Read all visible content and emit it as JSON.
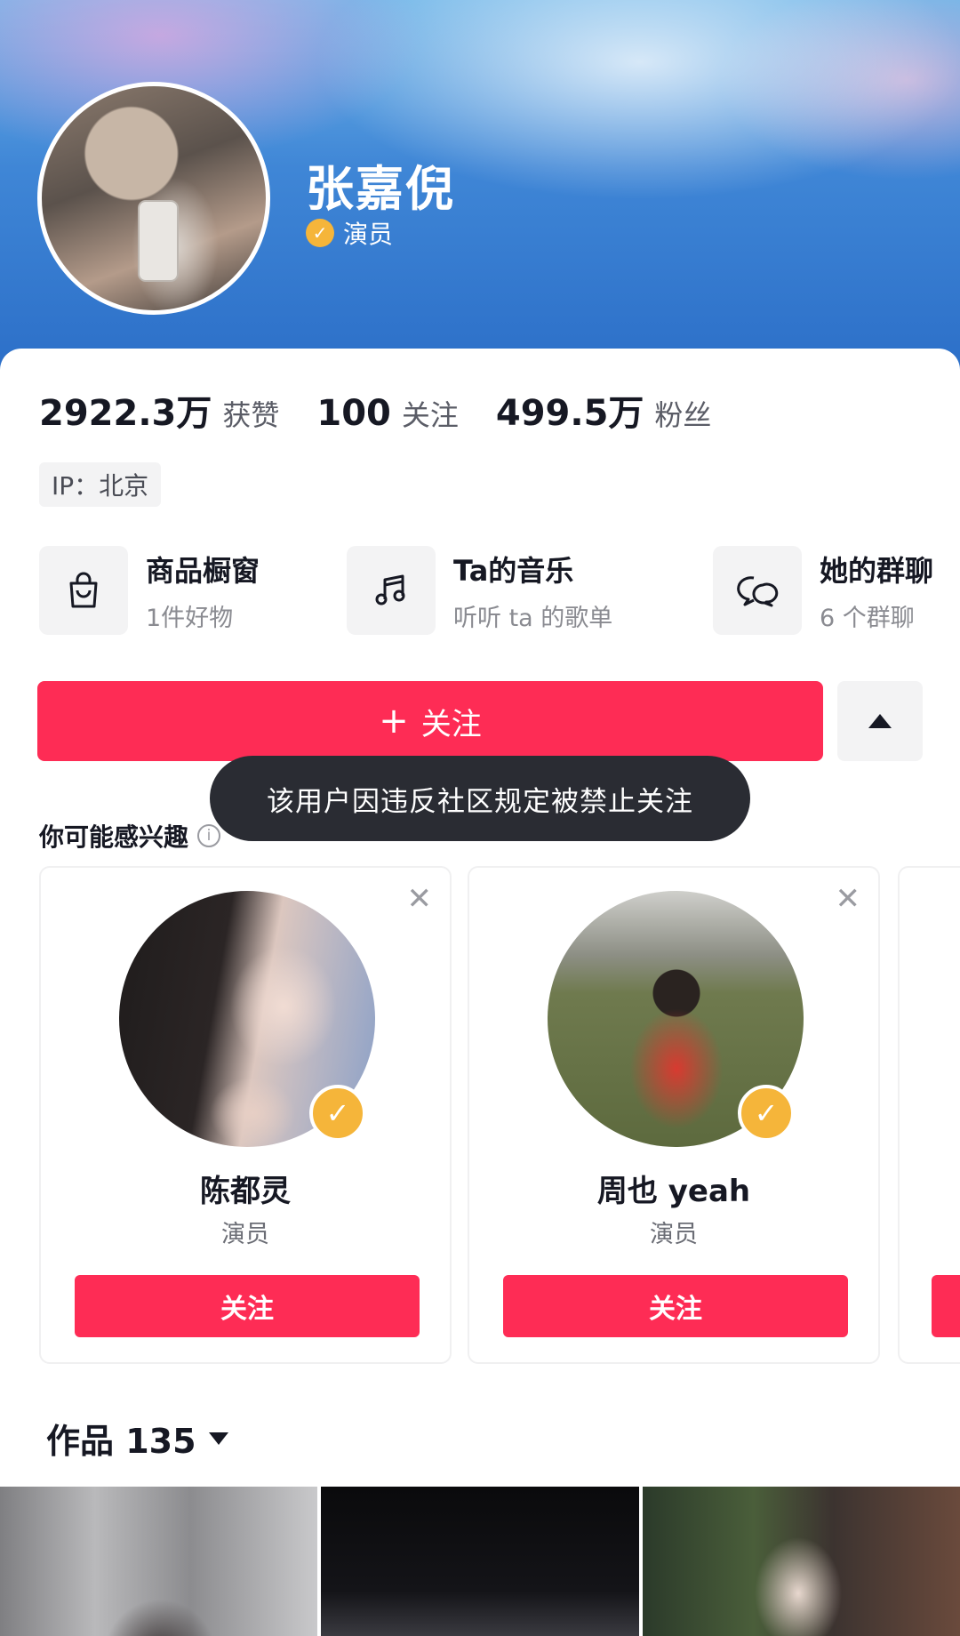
{
  "profile": {
    "name": "张嘉倪",
    "verify_label": "演员",
    "verify_icon": "check-badge-icon"
  },
  "stats": [
    {
      "value": "2922.3万",
      "label": "获赞"
    },
    {
      "value": "100",
      "label": "关注"
    },
    {
      "value": "499.5万",
      "label": "粉丝"
    }
  ],
  "ip": "IP：北京",
  "features": [
    {
      "title": "商品橱窗",
      "subtitle": "1件好物",
      "icon": "shopping-bag-icon"
    },
    {
      "title": "Ta的音乐",
      "subtitle": "听听 ta 的歌单",
      "icon": "music-note-icon"
    },
    {
      "title": "她的群聊",
      "subtitle": "6 个群聊",
      "icon": "chat-bubbles-icon"
    }
  ],
  "follow_button": {
    "icon": "+",
    "label": "关注"
  },
  "toast": "该用户因违反社区规定被禁止关注",
  "suggestions": {
    "title": "你可能感兴趣",
    "cards": [
      {
        "name": "陈都灵",
        "role": "演员",
        "button": "关注"
      },
      {
        "name": "周也 yeah",
        "role": "演员",
        "button": "关注"
      }
    ]
  },
  "works": {
    "label": "作品 135"
  },
  "colors": {
    "accent": "#fe2c55",
    "verified": "#f5b53a",
    "banner": "#3f86d6"
  }
}
